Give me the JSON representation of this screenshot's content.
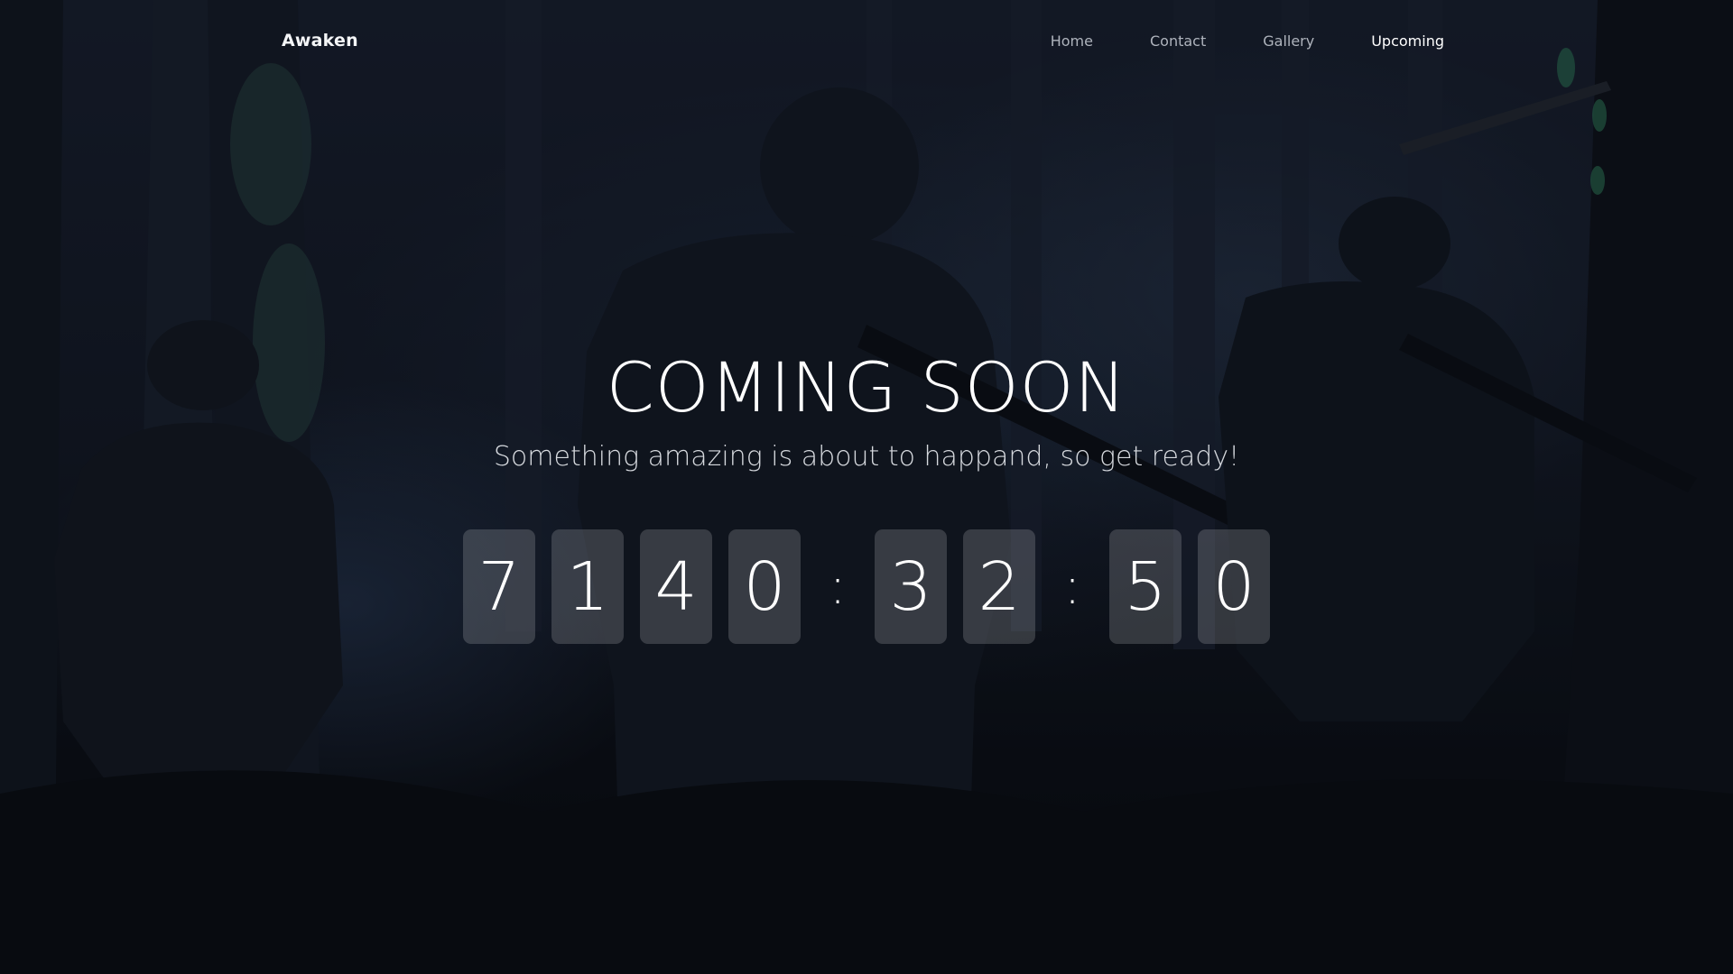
{
  "navbar": {
    "brand": "Awaken",
    "links": [
      {
        "label": "Home",
        "active": false
      },
      {
        "label": "Contact",
        "active": false
      },
      {
        "label": "Gallery",
        "active": false
      },
      {
        "label": "Upcoming",
        "active": true
      }
    ]
  },
  "hero": {
    "title": "COMING SOON",
    "subtitle": "Something amazing is about to happand, so get ready!"
  },
  "countdown": {
    "days": [
      "7",
      "1",
      "4",
      "0"
    ],
    "separator": ":",
    "hours": [
      "3",
      "2"
    ],
    "minutes": [
      "5",
      "0"
    ]
  },
  "colors": {
    "text": "#ffffff",
    "nav_inactive": "#aeb3bc",
    "digit_box": "rgba(255,255,255,0.17)",
    "background": "#0b0f18"
  }
}
